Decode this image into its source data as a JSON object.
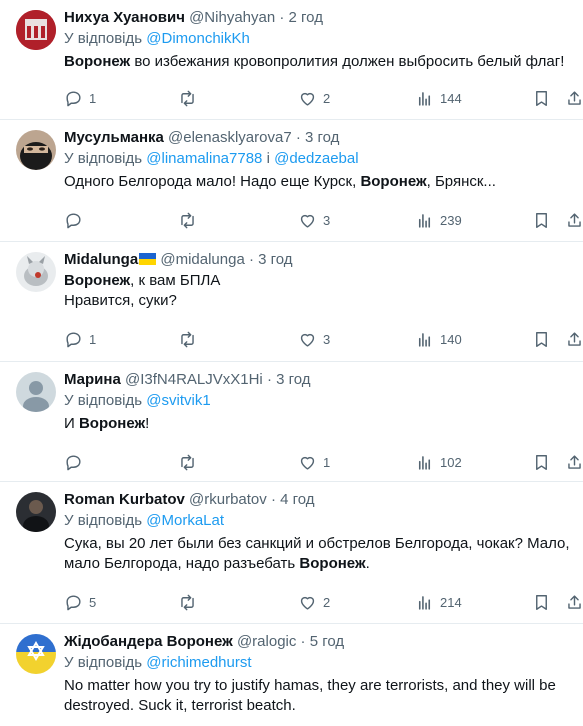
{
  "tweets": [
    {
      "name": "Нихуа Хуанович",
      "handle": "@Nihyahyan",
      "time": "2 год",
      "reply_prefix": "У відповідь",
      "reply_to": [
        "@DimonchikKh"
      ],
      "reply_joiner": "",
      "text_lines": [
        [
          {
            "b": true,
            "t": "Воронеж"
          },
          {
            "b": false,
            "t": " во избежания кровопролития должен выбросить белый флаг!"
          }
        ]
      ],
      "replies": "1",
      "likes": "2",
      "views": "144",
      "avatar_color": "#b0202a"
    },
    {
      "name": "Мусульманка",
      "handle": "@elenasklyarova7",
      "time": "3 год",
      "reply_prefix": "У відповідь",
      "reply_to": [
        "@linamalina7788",
        "@dedzaebal"
      ],
      "reply_joiner": "і",
      "text_lines": [
        [
          {
            "b": false,
            "t": "Одного Белгорода мало! Надо еще Курск, "
          },
          {
            "b": true,
            "t": "Воронеж"
          },
          {
            "b": false,
            "t": ", Брянск..."
          }
        ]
      ],
      "replies": "",
      "likes": "3",
      "views": "239",
      "avatar_color": "#8a6b55"
    },
    {
      "name": "Midalunga",
      "handle": "@midalunga",
      "time": "3 год",
      "reply_prefix": "",
      "reply_to": [],
      "reply_joiner": "",
      "text_lines": [
        [
          {
            "b": true,
            "t": "Воронеж"
          },
          {
            "b": false,
            "t": ", к вам БПЛА"
          }
        ],
        [
          {
            "b": false,
            "t": "Нравится, суки?"
          }
        ]
      ],
      "replies": "1",
      "likes": "3",
      "views": "140",
      "avatar_color": "#cfd3d6"
    },
    {
      "name": "Марина",
      "handle": "@I3fN4RALJVxX1Hi",
      "time": "3 год",
      "reply_prefix": "У відповідь",
      "reply_to": [
        "@svitvik1"
      ],
      "reply_joiner": "",
      "text_lines": [
        [
          {
            "b": false,
            "t": "И "
          },
          {
            "b": true,
            "t": "Воронеж"
          },
          {
            "b": false,
            "t": "!"
          }
        ]
      ],
      "replies": "",
      "likes": "1",
      "views": "102",
      "avatar_color": "#cfd9de"
    },
    {
      "name": "Roman Kurbatov",
      "handle": "@rkurbatov",
      "time": "4 год",
      "reply_prefix": "У відповідь",
      "reply_to": [
        "@MorkaLat"
      ],
      "reply_joiner": "",
      "text_lines": [
        [
          {
            "b": false,
            "t": "Сука, вы 20 лет были без санкций и обстрелов Белгорода, чокак? Мало,"
          }
        ],
        [
          {
            "b": false,
            "t": "мало Белгорода, надо разъебать "
          },
          {
            "b": true,
            "t": "Воронеж"
          },
          {
            "b": false,
            "t": "."
          }
        ]
      ],
      "replies": "5",
      "likes": "2",
      "views": "214",
      "avatar_color": "#2b2e33"
    },
    {
      "name": "Жідобандера Воронеж",
      "handle": "@ralogic",
      "time": "5 год",
      "reply_prefix": "У відповідь",
      "reply_to": [
        "@richimedhurst"
      ],
      "reply_joiner": "",
      "text_lines": [
        [
          {
            "b": false,
            "t": "No matter how you try to justify hamas, they are terrorists, and they will be"
          }
        ],
        [
          {
            "b": false,
            "t": "destroyed. Suck it, terrorist beatch."
          }
        ]
      ],
      "replies": "",
      "likes": "",
      "views": "",
      "avatar_color": "#8fb6e0"
    }
  ],
  "separator": "·"
}
